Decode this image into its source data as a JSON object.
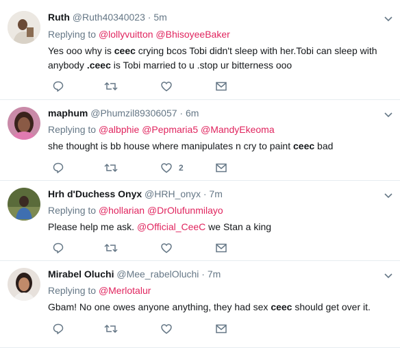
{
  "colors": {
    "mention": "#e0245e",
    "meta": "#657786",
    "divider": "#e6ecf0",
    "icon": "#657786"
  },
  "tweets": [
    {
      "name": "Ruth",
      "handle": "@Ruth40340023",
      "dot": "·",
      "time": "5m",
      "replying_label": "Replying to",
      "mentions": [
        "@lollyvuitton",
        "@BhisoyeeBaker"
      ],
      "text_parts": [
        "Yes ooo why is ",
        "ceec",
        " crying bcos Tobi didn't sleep with her.Tobi can sleep with anybody ",
        ".ceec",
        " is Tobi married to u .stop ur bitterness ooo"
      ],
      "like_count": ""
    },
    {
      "name": "maphum",
      "handle": "@Phumzil89306057",
      "dot": "·",
      "time": "6m",
      "replying_label": "Replying to",
      "mentions": [
        "@albphie",
        "@Pepmaria5",
        "@MandyEkeoma"
      ],
      "text_parts": [
        "she thought is bb house where manipulates n cry to paint ",
        "ceec",
        " bad"
      ],
      "like_count": "2"
    },
    {
      "name": "Hrh d'Duchess Onyx",
      "handle": "@HRH_onyx",
      "dot": "·",
      "time": "7m",
      "replying_label": "Replying to",
      "mentions": [
        "@hollarian",
        "@DrOlufunmilayo"
      ],
      "text_parts": [
        "Please help me ask. ",
        "@Official_CeeC",
        " we Stan a king"
      ],
      "like_count": ""
    },
    {
      "name": "Mirabel Oluchi",
      "handle": "@Mee_rabelOluchi",
      "dot": "·",
      "time": "7m",
      "replying_label": "Replying to",
      "mentions": [
        "@Merlotalur"
      ],
      "text_parts": [
        "Gbam! No one owes anyone anything, they had sex ",
        "ceec",
        " should get over it."
      ],
      "like_count": ""
    }
  ]
}
